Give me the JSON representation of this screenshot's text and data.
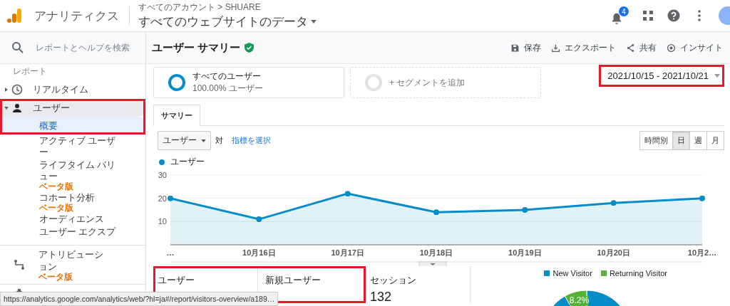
{
  "header": {
    "app_name": "アナリティクス",
    "breadcrumb": "すべてのアカウント > SHUARE",
    "view": "すべてのウェブサイトのデータ",
    "notification_count": "4"
  },
  "sidebar": {
    "search": {
      "placeholder": "レポートとヘルプを検索"
    },
    "section_label": "レポート",
    "items": [
      {
        "kind": "clock",
        "label": "リアルタイム",
        "selected": false,
        "expanded": false,
        "highlighted": false
      },
      {
        "kind": "person",
        "label": "ユーザー",
        "selected": true,
        "expanded": true,
        "highlighted": true,
        "children": [
          {
            "label": "概要",
            "selected": true
          },
          {
            "label": "アクティブ ユーザー",
            "selected": false
          },
          {
            "label": "ライフタイム バリュー",
            "badge": "ベータ版",
            "selected": false
          },
          {
            "label": "コホート分析",
            "badge": "ベータ版",
            "selected": false
          },
          {
            "label": "オーディエンス",
            "selected": false
          },
          {
            "label": "ユーザー エクスプ",
            "selected": false
          }
        ]
      }
    ],
    "attribution": {
      "label": "アトリビューション",
      "badge": "ベータ版"
    }
  },
  "page": {
    "title": "ユーザー サマリー",
    "actions": [
      {
        "kind": "save",
        "label": "保存"
      },
      {
        "kind": "export",
        "label": "エクスポート"
      },
      {
        "kind": "share",
        "label": "共有"
      },
      {
        "kind": "insight",
        "label": "インサイト"
      }
    ]
  },
  "segments": [
    {
      "kind": "active",
      "name": "すべてのユーザー",
      "detail": "100.00% ユーザー"
    },
    {
      "kind": "add",
      "name": "+ セグメントを追加"
    }
  ],
  "date_range": {
    "text": "2021/10/15 - 2021/10/21",
    "highlighted": true
  },
  "tabs": [
    {
      "label": "サマリー",
      "selected": true
    }
  ],
  "metric_select": "ユーザー",
  "versus": "対",
  "choose_metric": "指標を選択",
  "granularity": [
    {
      "label": "時間別",
      "selected": false
    },
    {
      "label": "日",
      "selected": true
    },
    {
      "label": "週",
      "selected": false
    },
    {
      "label": "月",
      "selected": false
    }
  ],
  "chart": {
    "chart_data": {
      "type": "area",
      "categories": [
        "…",
        "10月16日",
        "10月17日",
        "10月18日",
        "10月19日",
        "10月20日",
        "10月2…"
      ],
      "series": [
        {
          "name": "ユーザー",
          "color": "#058dc7",
          "values": [
            20,
            11,
            22,
            14,
            15,
            18,
            20
          ]
        }
      ],
      "ylim": [
        0,
        30
      ],
      "yticks": [
        10,
        20,
        30
      ]
    }
  },
  "metrics": [
    {
      "label": "ユーザー",
      "highlighted": true
    },
    {
      "label": "新規ユーザー",
      "highlighted": true
    },
    {
      "label": "セッション",
      "value": "132",
      "highlighted": false
    }
  ],
  "visitor_chart": {
    "legend": [
      {
        "label": "New Visitor",
        "color": "#058dc7"
      },
      {
        "label": "Returning Visitor",
        "color": "#50b432"
      }
    ],
    "chart_data": {
      "type": "pie",
      "values": [
        91.8,
        8.2
      ]
    },
    "slice_label": "8.2%"
  },
  "status_url": "https://analytics.google.com/analytics/web/?hl=ja#/report/visitors-overview/a189…"
}
